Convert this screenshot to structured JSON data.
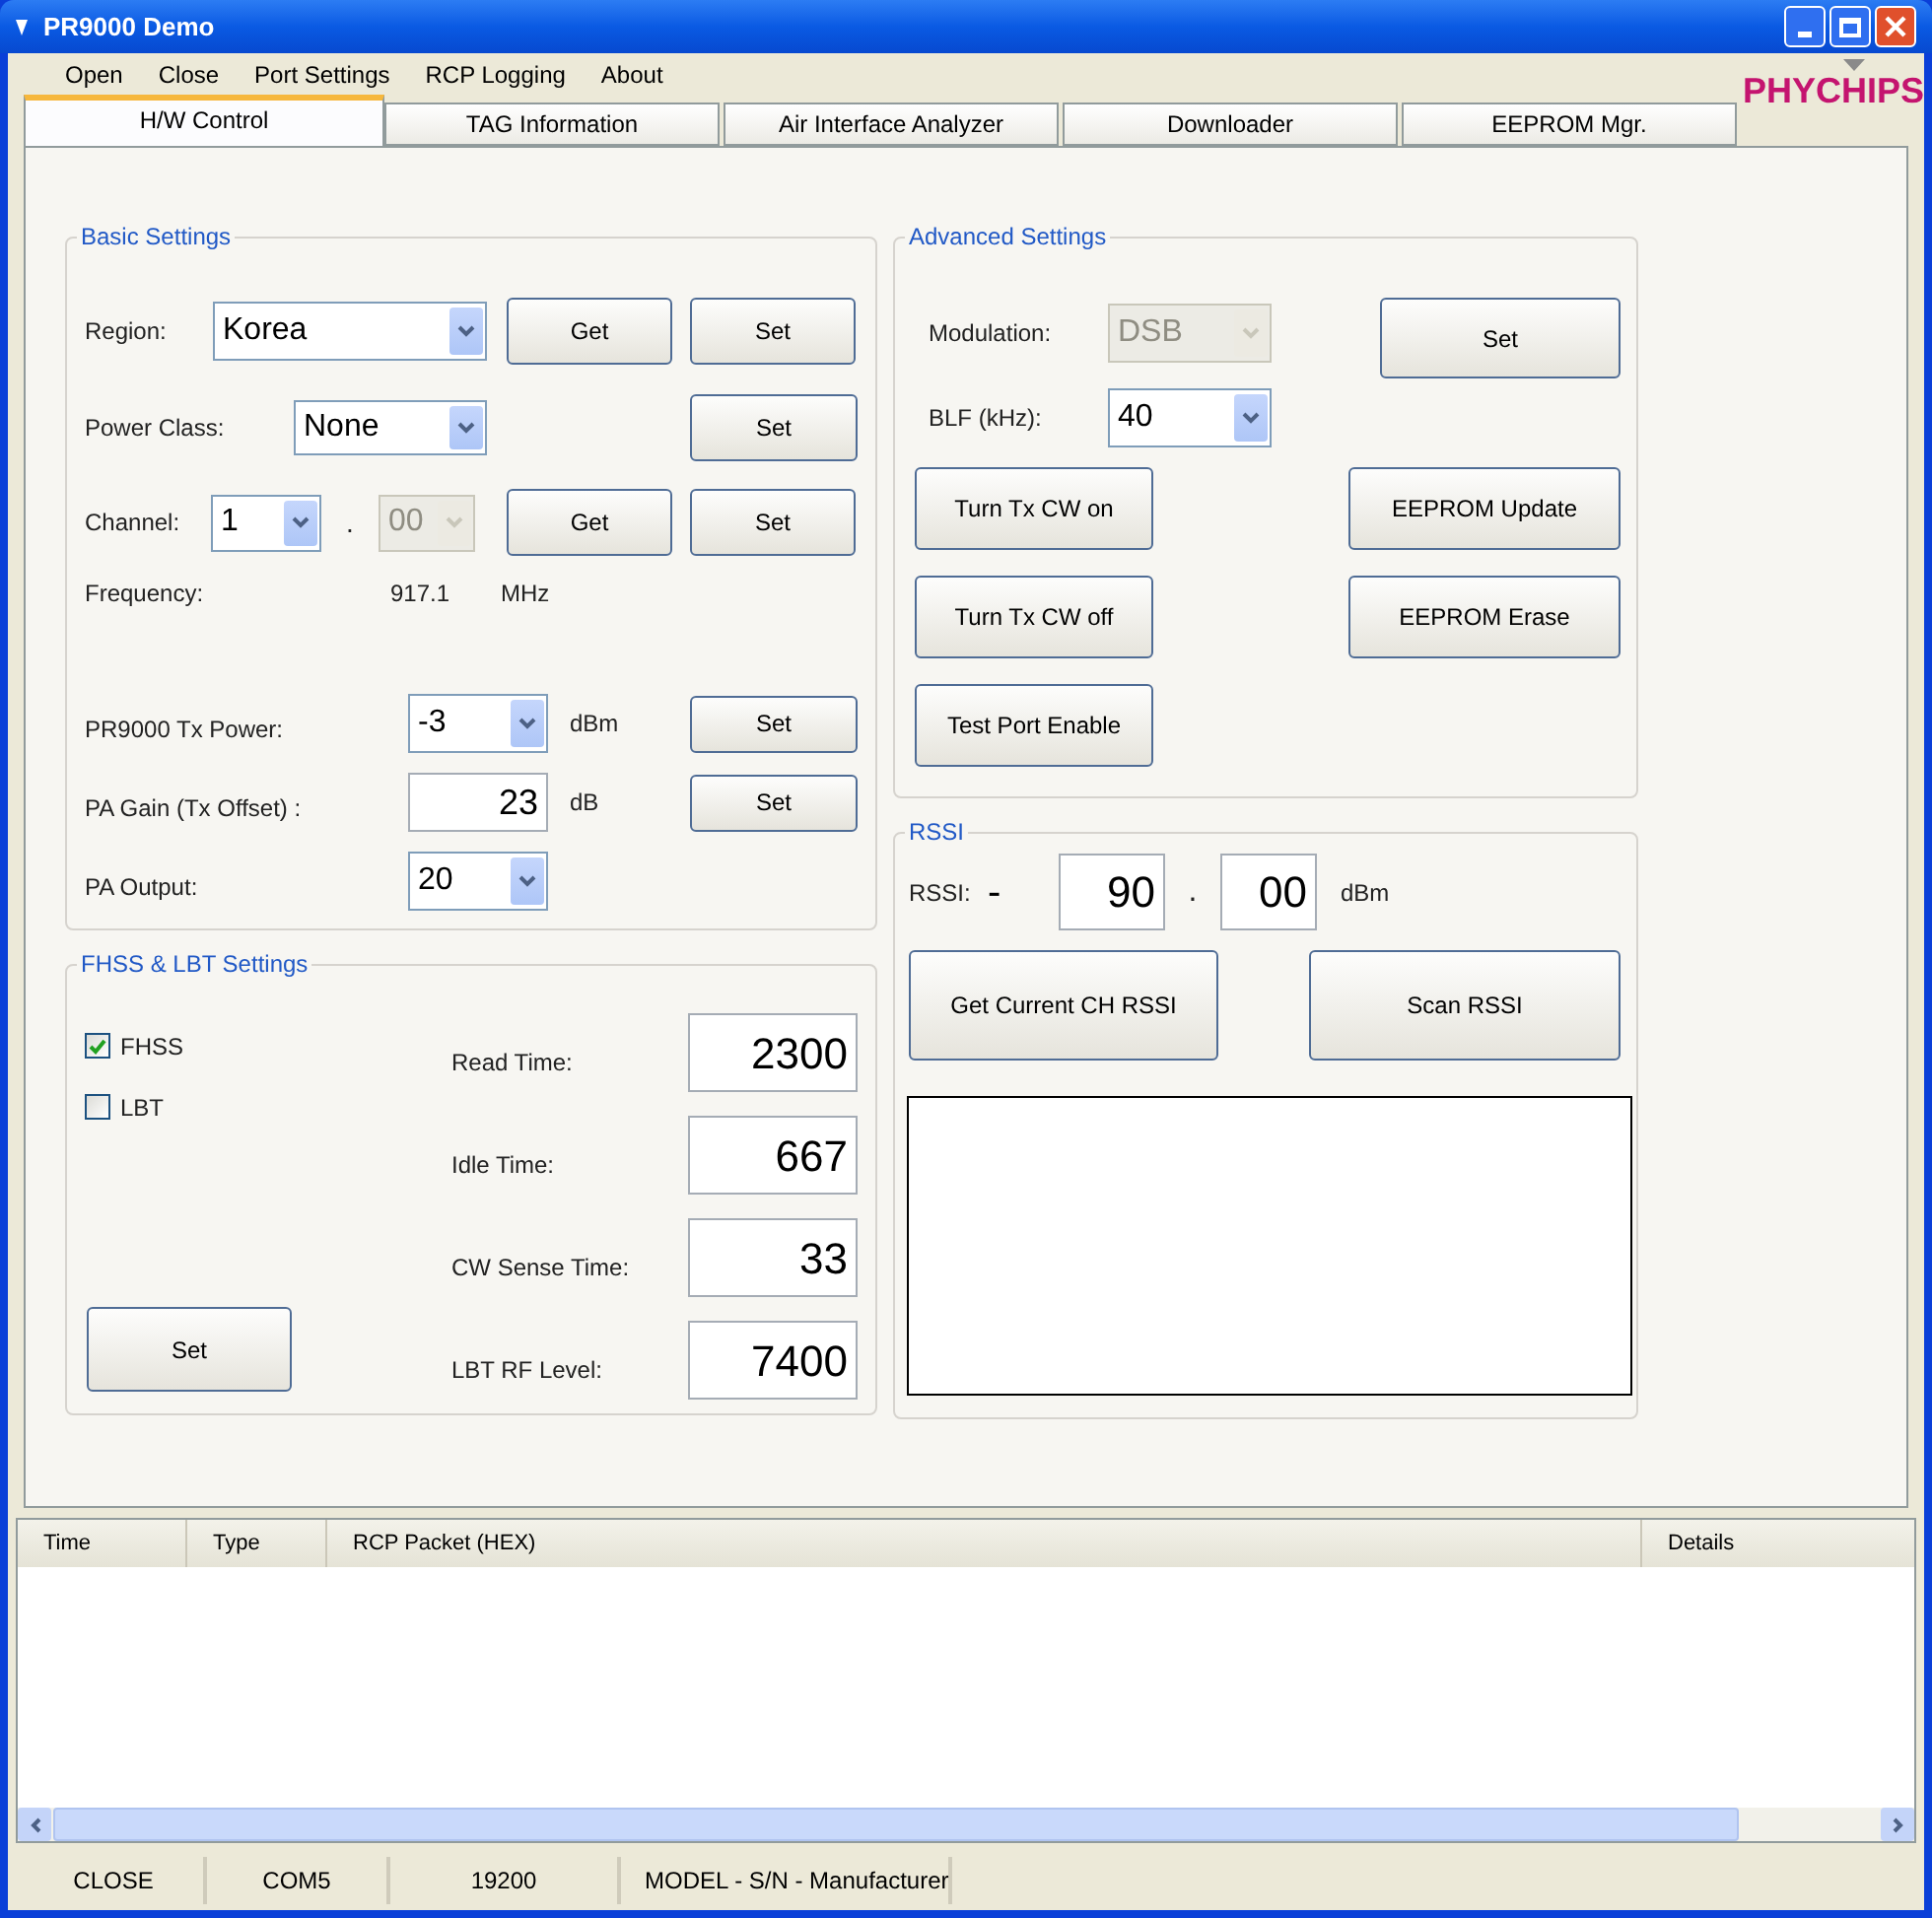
{
  "window": {
    "title": "PR9000 Demo"
  },
  "menu": [
    "Open",
    "Close",
    "Port Settings",
    "RCP Logging",
    "About"
  ],
  "logo": {
    "text": "PHYCHIPS"
  },
  "tabs": [
    {
      "label": "H/W Control",
      "selected": true
    },
    {
      "label": "TAG Information",
      "selected": false
    },
    {
      "label": "Air Interface Analyzer",
      "selected": false
    },
    {
      "label": "Downloader",
      "selected": false
    },
    {
      "label": "EEPROM Mgr.",
      "selected": false
    }
  ],
  "basic_settings": {
    "title": "Basic Settings",
    "region": {
      "label": "Region:",
      "value": "Korea",
      "buttons": [
        "Get",
        "Set"
      ]
    },
    "power_class": {
      "label": "Power Class:",
      "value": "None",
      "buttons": [
        "Set"
      ]
    },
    "channel": {
      "label": "Channel:",
      "value": "1",
      "separator": ".",
      "sub_value": "00",
      "sub_disabled": true,
      "buttons": [
        "Get",
        "Set"
      ]
    },
    "frequency": {
      "label": "Frequency:",
      "value": "917.1",
      "unit": "MHz"
    },
    "tx_power": {
      "label": "PR9000 Tx Power:",
      "value": "-3",
      "unit": "dBm",
      "buttons": [
        "Set"
      ]
    },
    "pa_gain": {
      "label": "PA Gain (Tx Offset) :",
      "value": "23",
      "unit": "dB",
      "buttons": [
        "Set"
      ]
    },
    "pa_output": {
      "label": "PA Output:",
      "value": "20"
    }
  },
  "fhss_lbt": {
    "title": "FHSS & LBT Settings",
    "checkboxes": [
      {
        "label": "FHSS",
        "checked": true
      },
      {
        "label": "LBT",
        "checked": false
      }
    ],
    "set_button": "Set",
    "fields": [
      {
        "label": "Read Time:",
        "value": "2300"
      },
      {
        "label": "Idle Time:",
        "value": "667"
      },
      {
        "label": "CW Sense Time:",
        "value": "33"
      },
      {
        "label": "LBT RF Level:",
        "value": "7400"
      }
    ]
  },
  "advanced_settings": {
    "title": "Advanced Settings",
    "modulation": {
      "label": "Modulation:",
      "value": "DSB",
      "disabled": true
    },
    "set_button": "Set",
    "blf": {
      "label": "BLF (kHz):",
      "value": "40",
      "disabled": false
    },
    "button_rows": [
      [
        "Turn Tx CW on",
        "EEPROM Update"
      ],
      [
        "Turn Tx CW off",
        "EEPROM Erase"
      ],
      [
        "Test Port Enable"
      ]
    ]
  },
  "rssi": {
    "title": "RSSI",
    "label": "RSSI:",
    "sign": "-",
    "integer": "90",
    "separator": ".",
    "fraction": "00",
    "unit": "dBm",
    "buttons": [
      "Get Current CH RSSI",
      "Scan RSSI"
    ]
  },
  "log": {
    "columns": [
      "Time",
      "Type",
      "RCP Packet (HEX)",
      "Details"
    ]
  },
  "status_bar": [
    "CLOSE",
    "COM5",
    "19200",
    "MODEL - S/N - Manufacturer"
  ]
}
